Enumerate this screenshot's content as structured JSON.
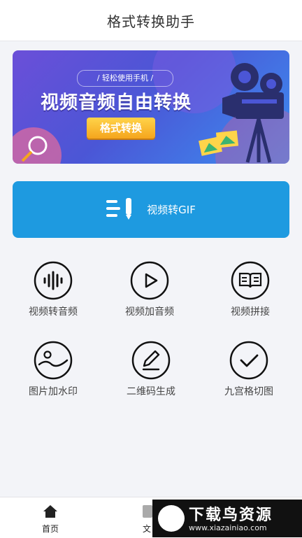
{
  "header": {
    "title": "格式转换助手"
  },
  "banner": {
    "subtitle": "/ 轻松使用手机 /",
    "headline": "视频音频自由转换",
    "button": "格式转换"
  },
  "gif_card": {
    "label": "视频转GIF",
    "icon": "text-edit-icon"
  },
  "tools": [
    {
      "label": "视频转音频",
      "icon": "audio-wave-icon"
    },
    {
      "label": "视频加音频",
      "icon": "play-icon"
    },
    {
      "label": "视频拼接",
      "icon": "book-icon"
    },
    {
      "label": "图片加水印",
      "icon": "landscape-icon"
    },
    {
      "label": "二维码生成",
      "icon": "pencil-icon"
    },
    {
      "label": "九宫格切图",
      "icon": "check-icon"
    }
  ],
  "tabbar": {
    "home": "首页",
    "second": "文"
  },
  "watermark": {
    "title": "下载鸟资源",
    "url": "www.xiazainiao.com"
  },
  "colors": {
    "primary": "#1e9ae0",
    "banner_start": "#6b4fd8",
    "banner_end": "#3c8ef0",
    "pill": "#f5a51d"
  }
}
